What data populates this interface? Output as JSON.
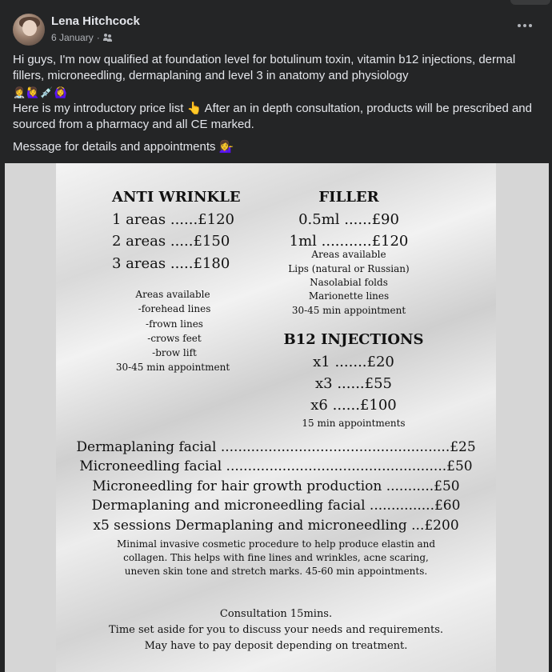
{
  "post": {
    "author": "Lena Hitchcock",
    "date": "6 January",
    "separator": "·",
    "paragraph1": "Hi guys, I'm now qualified at foundation level for botulinum toxin, vitamin b12 injections, dermal fillers, microneedling, dermaplaning and level 3 in anatomy and physiology",
    "emoji_line": "👩‍⚕️🙋‍♀️💉🙆‍♀️",
    "paragraph2": "Here is my introductory price list 👆 After an in depth consultation, products will be prescribed and sourced from a pharmacy and all CE marked.",
    "paragraph3": "Message for details and appointments 💁‍♀️"
  },
  "flyer": {
    "anti_wrinkle": {
      "title": "ANTI WRINKLE",
      "prices": [
        "1 areas ......£120",
        "2 areas .....£150",
        "3 areas .....£180"
      ],
      "areas_title": "Areas available",
      "areas": [
        "-forehead lines",
        "-frown lines",
        "-crows feet",
        "-brow lift"
      ],
      "duration": "30-45 min appointment"
    },
    "filler": {
      "title": "FILLER",
      "prices": [
        "0.5ml ......£90",
        "1ml ...........£120"
      ],
      "areas_title": "Areas available",
      "areas": [
        "Lips (natural or Russian)",
        "Nasolabial folds",
        "Marionette lines"
      ],
      "duration": "30-45 min appointment"
    },
    "b12": {
      "title": "B12 INJECTIONS",
      "prices": [
        "x1 .......£20",
        "x3 ......£55",
        "x6 ......£100"
      ],
      "duration": "15 min appointments"
    },
    "treatments": [
      "Dermaplaning facial .....................................................£25",
      "Microneedling facial ...................................................£50",
      "Microneedling for hair growth production ...........£50",
      "Dermaplaning and microneedling facial ...............£60",
      "x5 sessions Dermaplaning and microneedling ...£200"
    ],
    "treatment_note": [
      "Minimal invasive cosmetic procedure to help produce elastin and",
      "collagen.  This helps with fine lines and wrinkles, acne scaring,",
      "uneven skin tone and stretch marks. 45-60 min appointments."
    ],
    "consultation": [
      "Consultation 15mins.",
      "Time set aside for you to discuss your needs and requirements.",
      "May have to pay deposit depending on treatment."
    ]
  }
}
